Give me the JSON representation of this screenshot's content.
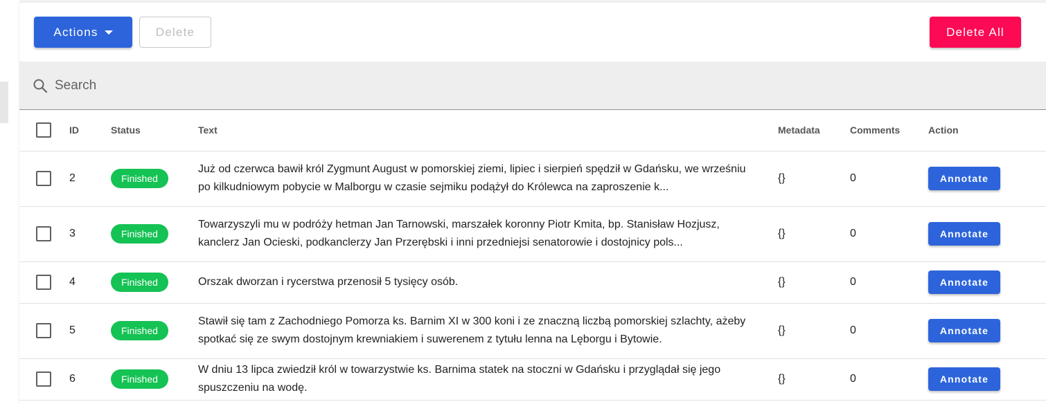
{
  "toolbar": {
    "actions_label": "Actions",
    "delete_label": "Delete",
    "delete_all_label": "Delete All"
  },
  "search": {
    "placeholder": "Search"
  },
  "table": {
    "headers": {
      "id": "ID",
      "status": "Status",
      "text": "Text",
      "metadata": "Metadata",
      "comments": "Comments",
      "action": "Action"
    },
    "rows": [
      {
        "id": "2",
        "status": "Finished",
        "text": "Już od czerwca bawił król Zygmunt August w pomorskiej ziemi, lipiec i sierpień spędził w Gdańsku, we wrześniu po kilkudniowym pobycie w Malborgu w czasie sejmiku podążył do Królewca na zaproszenie k...",
        "metadata": "{}",
        "comments": "0",
        "action": "Annotate"
      },
      {
        "id": "3",
        "status": "Finished",
        "text": "Towarzyszyli mu w podróży hetman Jan Tarnowski, marszałek koronny Piotr Kmita, bp. Stanisław Hozjusz, kanclerz Jan Ocieski, podkanclerzy Jan Przerębski i inni przedniejsi senatorowie i dostojnicy pols...",
        "metadata": "{}",
        "comments": "0",
        "action": "Annotate"
      },
      {
        "id": "4",
        "status": "Finished",
        "text": "Orszak dworzan i rycerstwa przenosił 5 tysięcy osób.",
        "metadata": "{}",
        "comments": "0",
        "action": "Annotate"
      },
      {
        "id": "5",
        "status": "Finished",
        "text": "Stawił się tam z Zachodniego Pomorza ks. Barnim XI w 300 koni i ze znaczną liczbą pomorskiej szlachty, ażeby spotkać się ze swym dostojnym krewniakiem i suwerenem z tytułu lenna na Lęborgu i Bytowie.",
        "metadata": "{}",
        "comments": "0",
        "action": "Annotate"
      },
      {
        "id": "6",
        "status": "Finished",
        "text": "W dniu 13 lipca zwiedził król w towarzystwie ks. Barnima statek na stoczni w Gdańsku i przyglądał się jego spuszczeniu na wodę.",
        "metadata": "{}",
        "comments": "0",
        "action": "Annotate"
      }
    ]
  },
  "colors": {
    "primary": "#2d64db",
    "danger": "#fc0a54",
    "status_finished": "#15c254"
  }
}
